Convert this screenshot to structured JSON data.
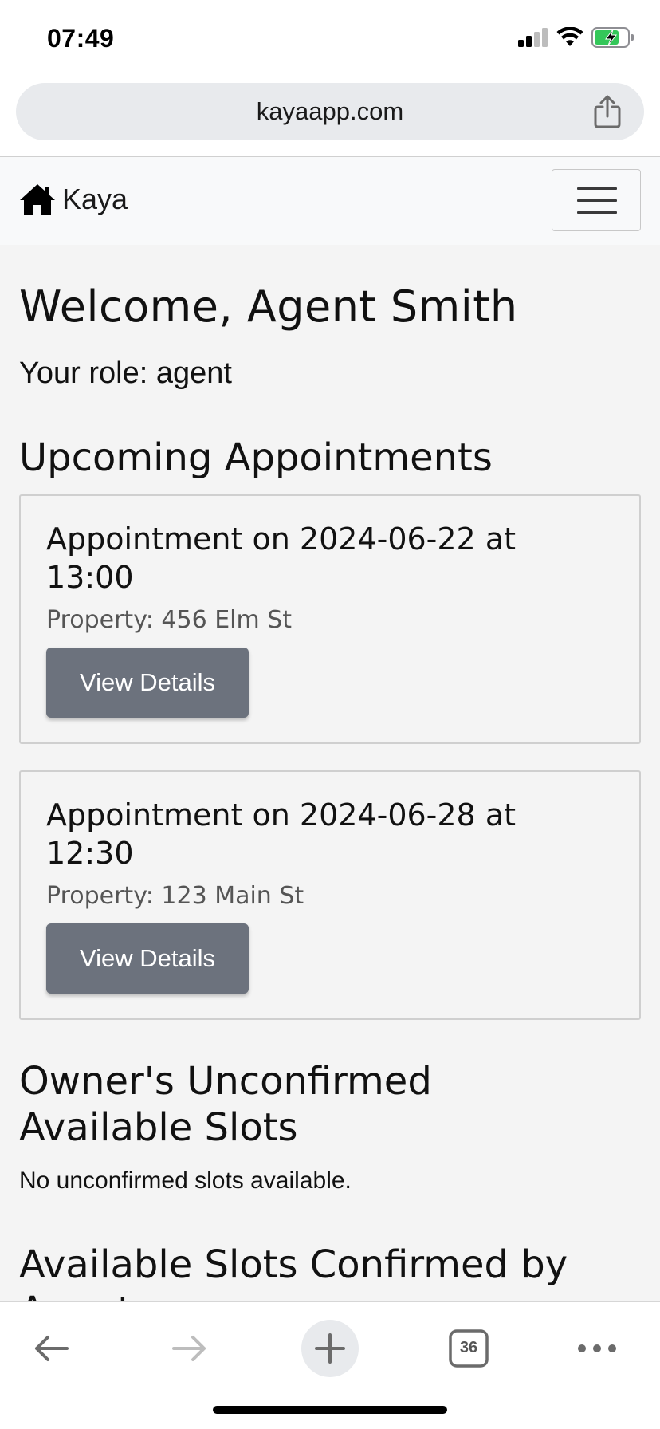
{
  "status_bar": {
    "time": "07:49",
    "icons": [
      "cellular-signal-icon",
      "wifi-icon",
      "battery-charging-icon"
    ]
  },
  "browser": {
    "url": "kayaapp.com",
    "share_icon": "share-icon",
    "tab_count": "36"
  },
  "navbar": {
    "brand": "Kaya",
    "brand_icon": "home-icon",
    "menu_icon": "hamburger-menu-icon"
  },
  "page": {
    "welcome": "Welcome, Agent Smith",
    "role": "Your role: agent",
    "upcoming_heading": "Upcoming Appointments",
    "appointments": [
      {
        "title": "Appointment on 2024-06-22 at 13:00",
        "property": "Property: 456 Elm St",
        "button": "View Details"
      },
      {
        "title": "Appointment on 2024-06-28 at 12:30",
        "property": "Property: 123 Main St",
        "button": "View Details"
      }
    ],
    "unconfirmed_heading": "Owner's Unconfirmed Available Slots",
    "unconfirmed_empty": "No unconfirmed slots available.",
    "confirmed_heading": "Available Slots Confirmed by Agent"
  },
  "colors": {
    "button_bg": "#6c727d",
    "content_bg": "#f4f4f4",
    "navbar_bg": "#f8f9fa",
    "battery_green": "#34c759"
  }
}
